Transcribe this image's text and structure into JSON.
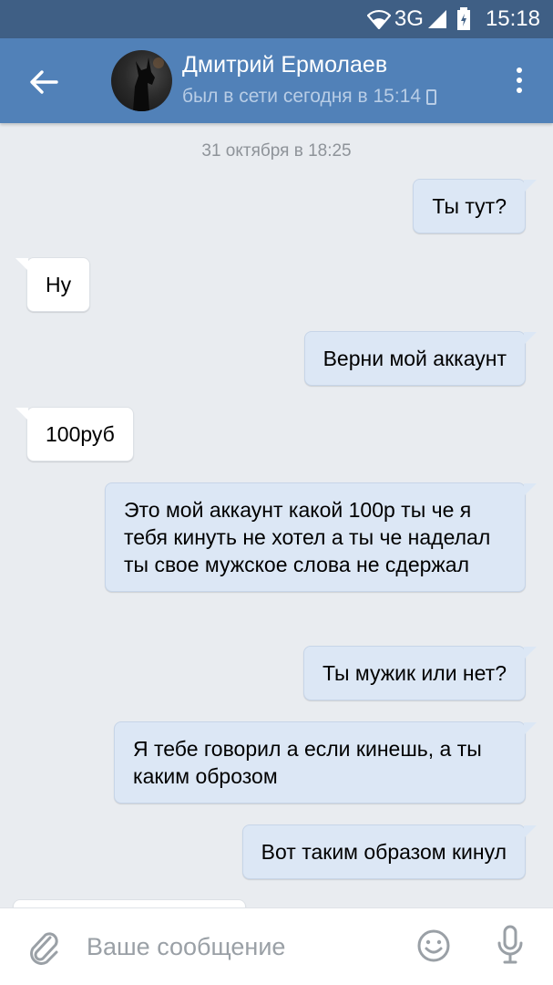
{
  "status_bar": {
    "network": "3G",
    "time": "15:18"
  },
  "header": {
    "back_icon": "arrow-left-icon",
    "contact_name": "Дмитрий Ермолаев",
    "last_seen": "был в сети сегодня в 15:14",
    "device_icon": "mobile-phone-icon",
    "menu_icon": "more-vertical-icon"
  },
  "chat": {
    "date_separator": "31 октября в 18:25",
    "messages": [
      {
        "direction": "out",
        "text": "Ты тут?"
      },
      {
        "direction": "in",
        "text": "Ну"
      },
      {
        "direction": "out",
        "text": "Верни мой аккаунт"
      },
      {
        "direction": "in",
        "text": "100руб"
      },
      {
        "direction": "out",
        "text": "Это мой аккаунт какой 100р ты че я тебя кинуть не хотел а ты че наделал ты свое мужское слова не сдержал"
      },
      {
        "direction": "out",
        "text": "Ты мужик или нет?"
      },
      {
        "direction": "out",
        "text": "Я тебе говорил а если кинешь, а ты каким оброзом"
      },
      {
        "direction": "out",
        "text": "Вот таким образом кинул"
      }
    ]
  },
  "composer": {
    "attach_icon": "paperclip-icon",
    "placeholder": "Ваше сообщение",
    "emoji_icon": "smiley-icon",
    "mic_icon": "microphone-icon"
  },
  "colors": {
    "header": "#5181b8",
    "status_bar": "#3f5f85",
    "background": "#e9ecf0",
    "outgoing_bubble": "#dce7f5",
    "incoming_bubble": "#ffffff"
  }
}
